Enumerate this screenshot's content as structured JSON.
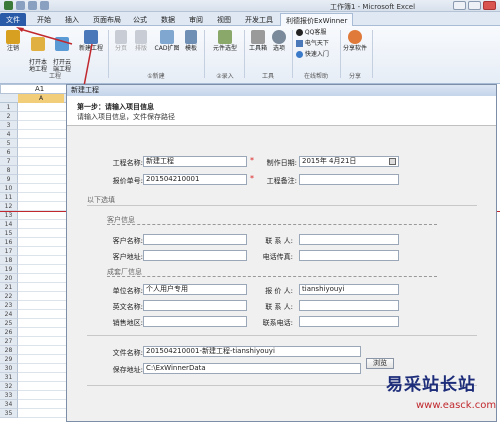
{
  "window": {
    "title": "工作簿1 - Microsoft Excel"
  },
  "tabs": [
    {
      "label": "文件"
    },
    {
      "label": "开始"
    },
    {
      "label": "插入"
    },
    {
      "label": "页面布局"
    },
    {
      "label": "公式"
    },
    {
      "label": "数据"
    },
    {
      "label": "审阅"
    },
    {
      "label": "视图"
    },
    {
      "label": "开发工具"
    },
    {
      "label": "利德报价ExWinner"
    }
  ],
  "ribbon": {
    "buttons": {
      "logout": "注销",
      "open_local": "打开本\n地工程",
      "open_cloud": "打开云\n端工程",
      "new_project": "新建工程",
      "split": "分页",
      "layout": "排版",
      "cad": "CAD扩图",
      "template": "模板",
      "component": "元件选型",
      "toolbox": "工具箱",
      "options": "选项",
      "qq": "QQ客服",
      "phone": "电气天下",
      "quickstart": "快速入门",
      "share": "分享软件"
    },
    "groups": {
      "project": "工程",
      "new": "①新建",
      "insert": "②录入",
      "tools": "工具",
      "help": "在线帮助",
      "share": "分享"
    }
  },
  "namebox": {
    "value": "A1"
  },
  "sheet": {
    "column_a": "A",
    "rows": [
      "1",
      "2",
      "3",
      "4",
      "5",
      "6",
      "7",
      "8",
      "9",
      "10",
      "11",
      "12",
      "13",
      "14",
      "15",
      "16",
      "17",
      "18",
      "19",
      "20",
      "21",
      "22",
      "23",
      "24",
      "25",
      "26",
      "27",
      "28",
      "29",
      "30",
      "31",
      "32",
      "33",
      "34",
      "35"
    ]
  },
  "dialog": {
    "title": "新建工程",
    "step_title": "第一步：请输入项目信息",
    "step_subtitle": "请输入项目信息，文件保存路径",
    "project_name_label": "工程名称:",
    "project_name_value": "新建工程",
    "date_label": "制作日期:",
    "date_value": "2015年 4月21日",
    "quote_no_label": "报价单号:",
    "quote_no_value": "201504210001",
    "remark_label": "工程备注:",
    "remark_value": "",
    "optional_label": "以下选填",
    "customer_section": "客户信息",
    "customer_name_label": "客户名称:",
    "contact_label": "联 系 人:",
    "customer_addr_label": "客户地址:",
    "phone_label": "电话传真:",
    "maker_section": "成套厂信息",
    "unit_name_label": "单位名称:",
    "unit_name_value": "个人用户专用",
    "quoter_label": "报 价 人:",
    "quoter_value": "tianshiyouyi",
    "en_name_label": "英文名称:",
    "contact2_label": "联 系 人:",
    "sales_area_label": "销售地区:",
    "contact_phone_label": "联系电话:",
    "file_name_label": "文件名称:",
    "file_name_value": "201504210001-新建工程-tianshiyouyi",
    "save_path_label": "保存地址:",
    "save_path_value": "C:\\ExWinnerData",
    "browse_label": "浏览"
  },
  "watermark": {
    "text": "易采站长站",
    "url": "www.easck.com"
  },
  "colors": {
    "annotation_red": "#c0282d",
    "file_tab": "#2a5ba8"
  }
}
